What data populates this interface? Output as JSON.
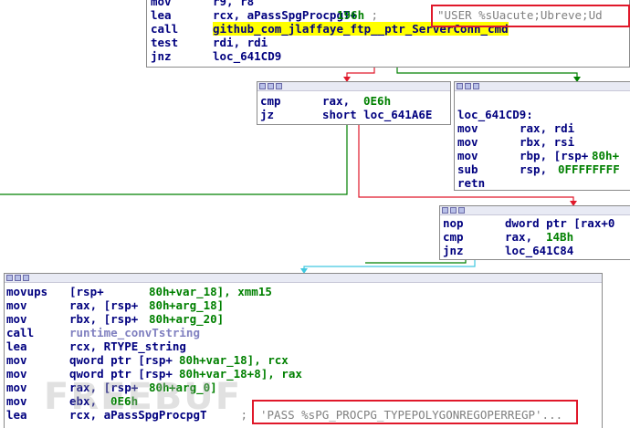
{
  "colors": {
    "red": "#e0182a",
    "green": "#008000",
    "cyan": "#40c8e0",
    "highlight": "#ffff00"
  },
  "block1": {
    "rows": [
      {
        "mn": "mov",
        "ops": "r9, r8"
      },
      {
        "mn": "lea",
        "op_a": "rcx, aPassSpgProcpgT+",
        "op_b": "196h",
        "comment": " ; ",
        "str": "\"USER %sUacute;Ubreve;Ud"
      },
      {
        "mn": "call",
        "op_a": "github_com_jlaffaye_ftp__ptr_ServerConn_cmd"
      },
      {
        "mn": "test",
        "op_a": "rdi, rdi"
      },
      {
        "mn": "jnz",
        "op_a": "loc_641CD9"
      }
    ]
  },
  "block2": {
    "rows": [
      {
        "mn": "cmp",
        "op_a": "rax, ",
        "op_b": "0E6h"
      },
      {
        "mn": "jz",
        "op_a": "short loc_641A6E"
      }
    ]
  },
  "block3": {
    "rows": [
      {
        "label": "loc_641CD9:"
      },
      {
        "mn": "mov",
        "op_a": "rax, rdi"
      },
      {
        "mn": "mov",
        "op_a": "rbx, rsi"
      },
      {
        "mn": "mov",
        "op_a": "rbp, [rsp+",
        "op_b": "80h+"
      },
      {
        "mn": "sub",
        "op_a": "rsp, ",
        "op_b": "0FFFFFFFF"
      },
      {
        "mn": "retn"
      }
    ]
  },
  "block4": {
    "rows": [
      {
        "mn": "nop",
        "op_a": "dword ptr [rax+0"
      },
      {
        "mn": "cmp",
        "op_a": "rax, ",
        "op_b": "14Bh"
      },
      {
        "mn": "jnz",
        "op_a": "loc_641C84"
      }
    ]
  },
  "block5": {
    "rows": [
      {
        "mn": "movups",
        "op_a": "[rsp+",
        "op_b": "80h",
        "op_c": "+var_18], xmm15"
      },
      {
        "mn": "mov",
        "op_a": "rax, [rsp+",
        "op_b": "80h",
        "op_c": "+arg_18]"
      },
      {
        "mn": "mov",
        "op_a": "rbx, [rsp+",
        "op_b": "80h",
        "op_c": "+arg_20]"
      },
      {
        "mn": "call",
        "fn": "runtime_convTstring"
      },
      {
        "mn": "lea",
        "op_a": "rcx, RTYPE_string"
      },
      {
        "mn": "mov",
        "op_a": "qword ptr [rsp+",
        "op_b": "80h",
        "op_c": "+var_18], rcx"
      },
      {
        "mn": "mov",
        "op_a": "qword ptr [rsp+",
        "op_b": "80h",
        "op_c": "+var_18+8], rax"
      },
      {
        "mn": "mov",
        "op_a": "rax, [rsp+",
        "op_b": "80h",
        "op_c": "+arg_0]"
      },
      {
        "mn": "mov",
        "op_a": "ebx, ",
        "op_b": "0E6h"
      },
      {
        "mn": "lea",
        "op_a": "rcx, aPassSpgProcpgT",
        "comment": " ; ",
        "str": "'PASS %sPG_PROCPG_TYPEPOLYGONREGOPERREGP'..."
      }
    ]
  },
  "watermark": "FREEBUF"
}
